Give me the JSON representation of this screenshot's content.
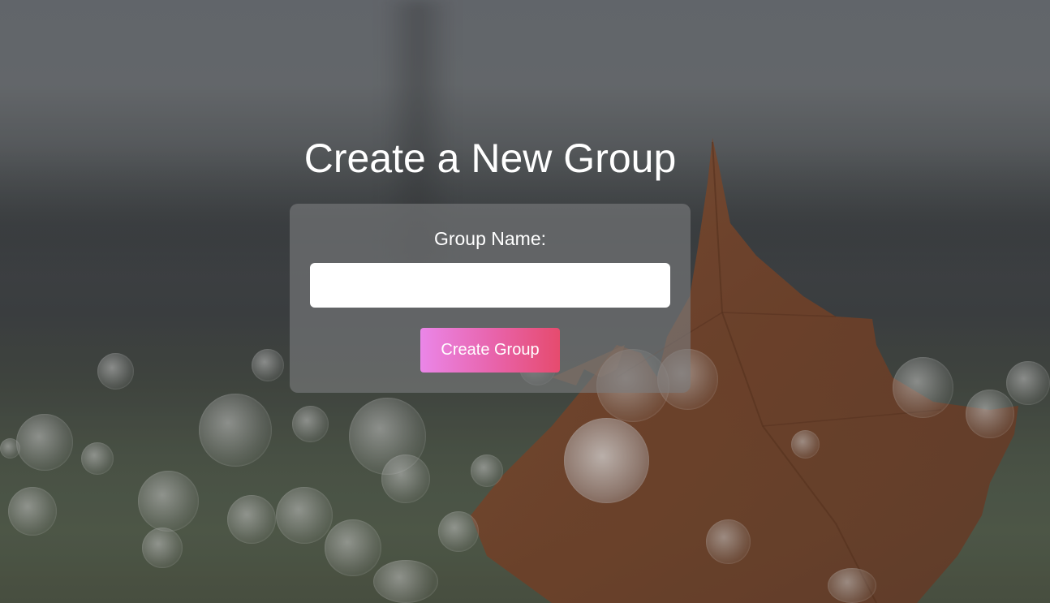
{
  "page": {
    "title": "Create a New Group"
  },
  "form": {
    "group_name_label": "Group Name:",
    "group_name_value": "",
    "submit_label": "Create Group"
  },
  "colors": {
    "title_text": "#ffffff",
    "card_background": "rgba(122,124,126,0.62)",
    "button_gradient_start": "#ea86e8",
    "button_gradient_end": "#e64b6e"
  }
}
